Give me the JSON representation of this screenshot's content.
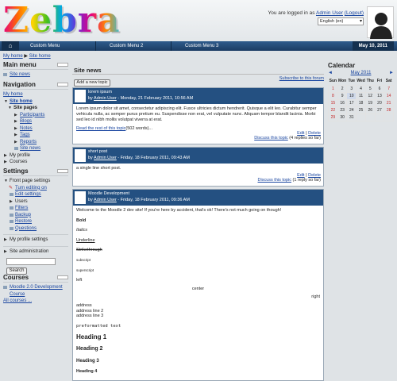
{
  "header": {
    "logo_text": "Zebra",
    "login_prefix": "You are logged in as ",
    "user_name": "Admin User",
    "logout_label": "(Logout)",
    "language": "English (en)"
  },
  "menubar": {
    "items": [
      "Custom Menu",
      "Custom Menu 2",
      "Custom Menu 3"
    ],
    "date": "May 10, 2011"
  },
  "breadcrumb": {
    "home": "My home",
    "current": "Site home"
  },
  "main_menu": {
    "title": "Main menu",
    "items": [
      "Site news"
    ]
  },
  "navigation": {
    "title": "Navigation",
    "my_home": "My home",
    "site_home": "Site home",
    "site_pages": "Site pages",
    "pages": [
      "Participants",
      "Blogs",
      "Notes",
      "Tags",
      "Reports",
      "Site news"
    ],
    "my_profile": "My profile",
    "courses": "Courses"
  },
  "settings": {
    "title": "Settings",
    "front_page": "Front page settings",
    "items": [
      "Turn editing on",
      "Edit settings",
      "Users",
      "Filters",
      "Backup",
      "Restore",
      "Questions"
    ],
    "my_profile_settings": "My profile settings",
    "site_admin": "Site administration",
    "search_button": "Search"
  },
  "courses": {
    "title": "Courses",
    "course": "Moodle 2.0 Development Course",
    "all": "All courses ..."
  },
  "main": {
    "title": "Site news",
    "add_topic": "Add a new topic",
    "subscribe": "Subscribe to this forum"
  },
  "posts": [
    {
      "subject": "lorem ipsum",
      "by": "by ",
      "author": "Admin User",
      "date": " - Monday, 21 February 2011, 10:56 AM",
      "body": "Lorem ipsum dolor sit amet, consectetur adipiscing elit. Fusce ultricies dictum hendrerit. Quisque a elit leo. Curabitur semper vehicula nulla, ac semper purus pretium eu. Suspendisse non erat, vel vulputate nunc. Aliquam tempor blandit lacinia. Morbi sed leo id nibh mollis volutpat viverra at erat.",
      "read_rest": "Read the rest of this topic",
      "words": "(502 words)...",
      "edit": "Edit",
      "delete": "Delete",
      "discuss": "Discuss this topic",
      "replies": " (4 replies so far)"
    },
    {
      "subject": "short post",
      "by": "by ",
      "author": "Admin User",
      "date": " - Friday, 18 February 2011, 09:43 AM",
      "body": "a single line short post.",
      "edit": "Edit",
      "delete": "Delete",
      "discuss": "Discuss this topic",
      "replies": " (1 reply so far)"
    },
    {
      "subject": "Moodle Development",
      "by": "by ",
      "author": "Admin User",
      "date": " - Friday, 18 February 2011, 09:36 AM",
      "intro": "Welcome to the Moodle 2 dev site!  If you're here by accident, that's ok!  There's not much going on though!",
      "bold": "Bold",
      "italics": "Italics",
      "underline": "Underline",
      "strike": "Strikethrough",
      "subscript": "subscript",
      "superscript": "superscript",
      "left": "left",
      "center": "center",
      "right": "right",
      "address": [
        "address",
        "address line 2",
        "address line 3"
      ],
      "pre": "preformatted text",
      "h1": "Heading 1",
      "h2": "Heading 2",
      "h3": "Heading 3",
      "h4": "Heading 4"
    }
  ],
  "calendar": {
    "title": "Calendar",
    "month": "May 2011",
    "prev": "◄",
    "next": "►",
    "days": [
      "Sun",
      "Mon",
      "Tue",
      "Wed",
      "Thu",
      "Fri",
      "Sat"
    ],
    "weeks": [
      [
        "1",
        "2",
        "3",
        "4",
        "5",
        "6",
        "7"
      ],
      [
        "8",
        "9",
        "10",
        "11",
        "12",
        "13",
        "14"
      ],
      [
        "15",
        "16",
        "17",
        "18",
        "19",
        "20",
        "21"
      ],
      [
        "22",
        "23",
        "24",
        "25",
        "26",
        "27",
        "28"
      ],
      [
        "29",
        "30",
        "31",
        "",
        "",
        "",
        ""
      ]
    ],
    "today": "10"
  },
  "colors": {
    "menubar": "#245081",
    "link": "#1a46a0",
    "weekend": "#c62828"
  }
}
